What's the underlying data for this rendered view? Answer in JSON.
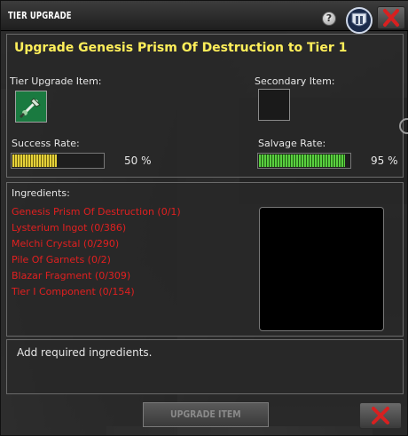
{
  "window": {
    "title": "TIER UPGRADE"
  },
  "header": {
    "upgrade_title": "Upgrade Genesis Prism Of Destruction to Tier 1"
  },
  "items": {
    "tier_label": "Tier Upgrade Item:",
    "secondary_label": "Secondary Item:",
    "tier_item_icon": "prism-weapon-icon"
  },
  "rates": {
    "success_label": "Success Rate:",
    "success_value": "50 %",
    "success_fraction": 0.5,
    "salvage_label": "Salvage Rate:",
    "salvage_value": "95 %",
    "salvage_fraction": 0.95
  },
  "ingredients": {
    "header": "Ingredients:",
    "list": [
      "Genesis Prism Of Destruction (0/1)",
      "Lysterium Ingot (0/386)",
      "Melchi Crystal (0/290)",
      "Pile Of Garnets (0/2)",
      "Blazar Fragment (0/309)",
      "Tier I Component (0/154)"
    ]
  },
  "message": {
    "text": "Add required ingredients."
  },
  "buttons": {
    "upgrade_label": "UPGRADE ITEM"
  },
  "colors": {
    "title_yellow": "#ffef5a",
    "missing_red": "#e02020",
    "close_x_red": "#d82020"
  }
}
